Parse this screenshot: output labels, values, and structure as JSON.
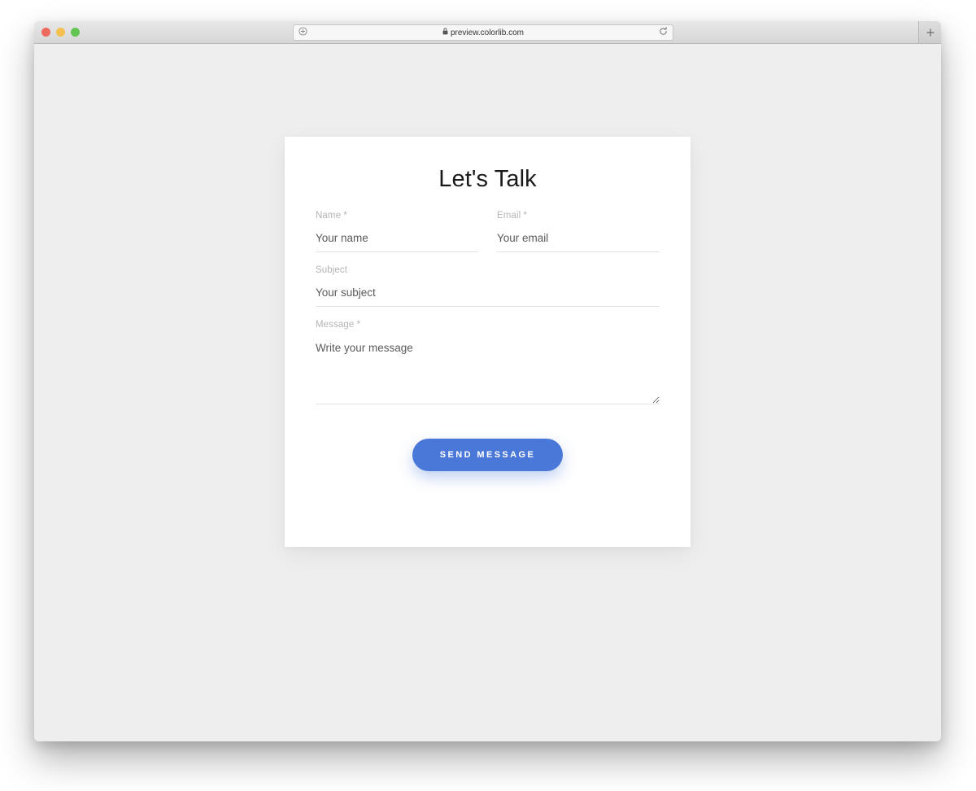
{
  "browser": {
    "traffic_lights": [
      {
        "name": "close",
        "color": "#ed6a5e"
      },
      {
        "name": "minimize",
        "color": "#f5c04f"
      },
      {
        "name": "zoom",
        "color": "#62c554"
      }
    ],
    "address_bar": {
      "url": "preview.colorlib.com",
      "lock_icon": "lock-icon",
      "add_bookmark_icon": "add-bookmark-icon",
      "reload_icon": "reload-icon"
    },
    "new_tab_label": "+"
  },
  "card": {
    "title": "Let's Talk",
    "fields": [
      {
        "key": "name",
        "label": "Name *",
        "placeholder": "Your name",
        "value": ""
      },
      {
        "key": "email",
        "label": "Email *",
        "placeholder": "Your email",
        "value": ""
      },
      {
        "key": "subject",
        "label": "Subject",
        "placeholder": "Your subject",
        "value": ""
      },
      {
        "key": "message",
        "label": "Message *",
        "placeholder": "Write your message",
        "value": ""
      }
    ],
    "submit_label": "SEND MESSAGE",
    "accent_color": "#4a78d8"
  }
}
